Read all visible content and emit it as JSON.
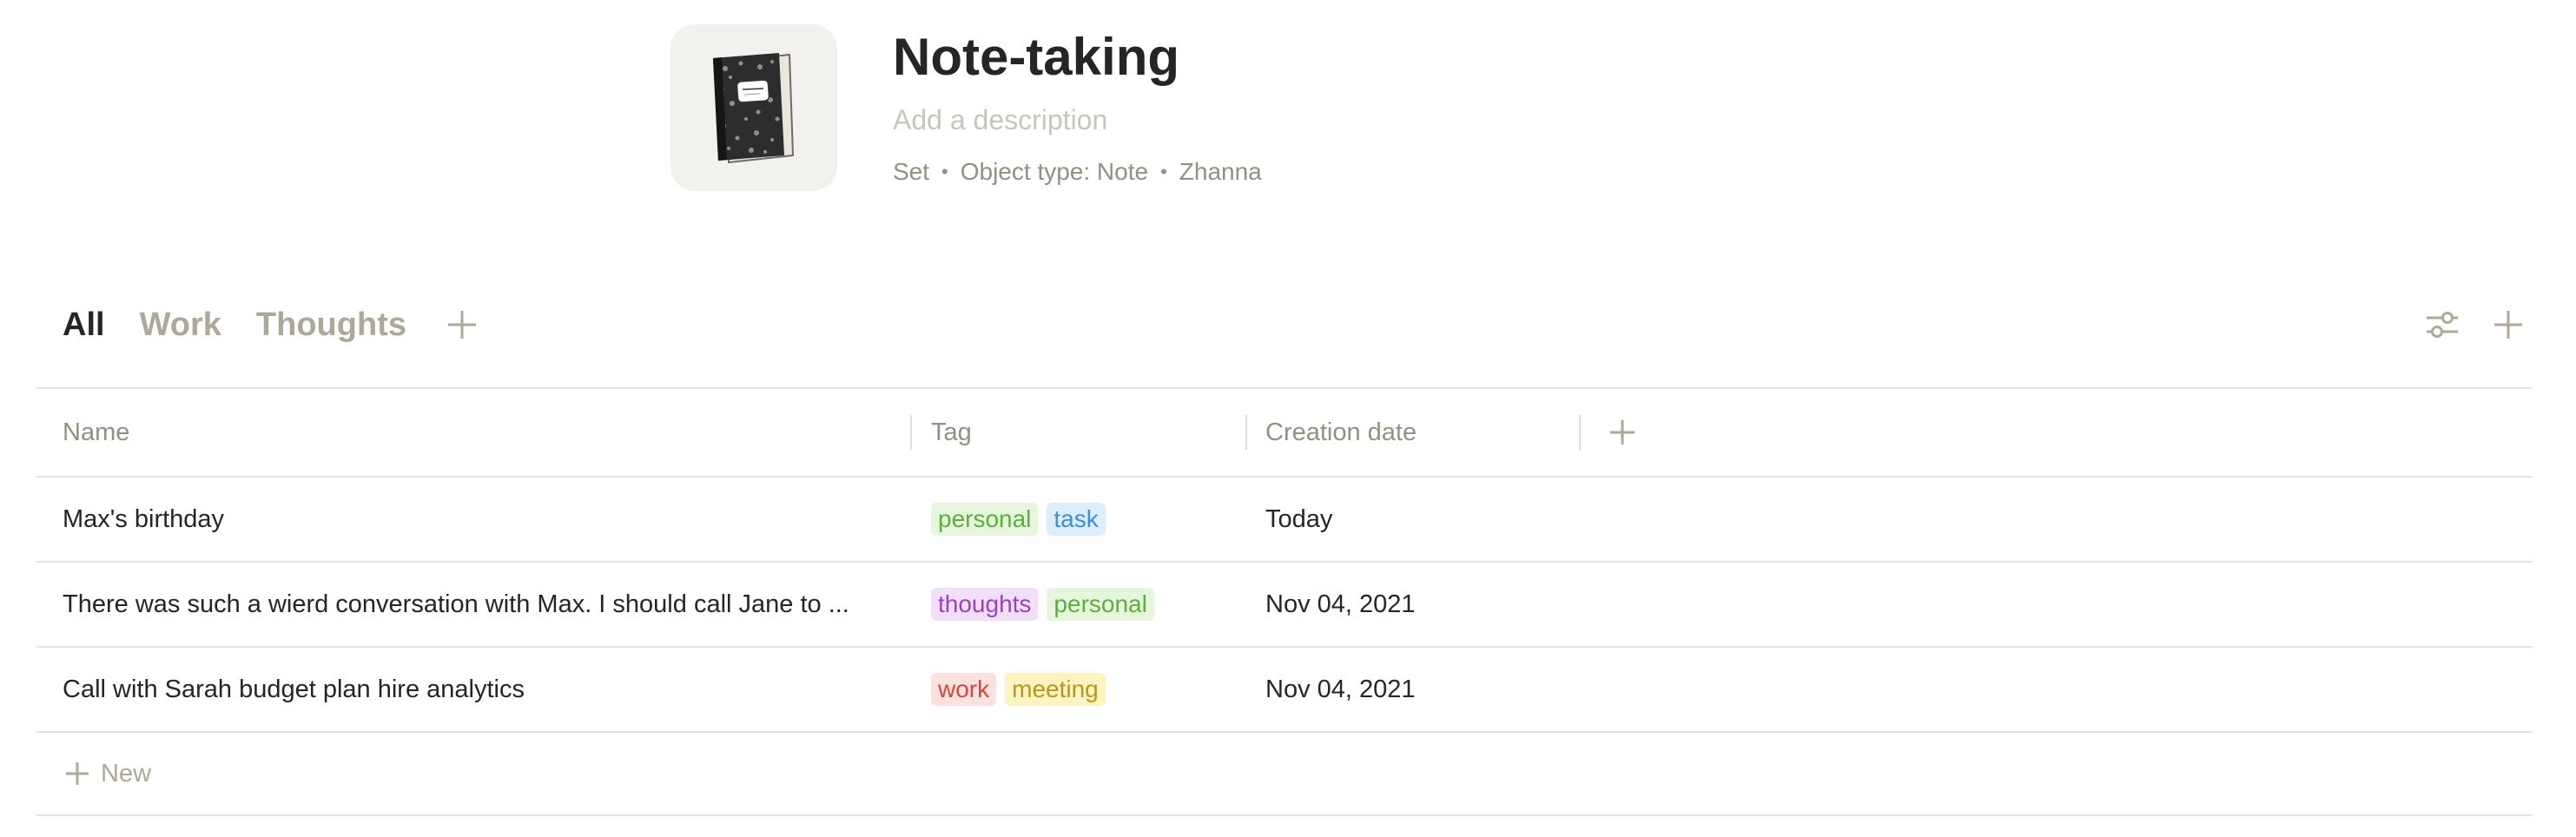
{
  "header": {
    "icon": "notebook-icon",
    "title": "Note-taking",
    "description_placeholder": "Add a description",
    "meta": {
      "kind": "Set",
      "object_type": "Object type: Note",
      "author": "Zhanna"
    }
  },
  "views": {
    "tabs": [
      {
        "label": "All",
        "active": true
      },
      {
        "label": "Work",
        "active": false
      },
      {
        "label": "Thoughts",
        "active": false
      }
    ],
    "add_icon": "plus-icon",
    "toolbar_icons": [
      "settings-sliders-icon",
      "plus-icon"
    ]
  },
  "table": {
    "columns": [
      "Name",
      "Tag",
      "Creation date"
    ],
    "add_column_icon": "plus-icon",
    "rows": [
      {
        "name": "Max's birthday",
        "tags": [
          {
            "label": "personal",
            "color": "#5dae3b",
            "bg": "#e6f6dc"
          },
          {
            "label": "task",
            "color": "#3e8fd8",
            "bg": "#dcedfb"
          }
        ],
        "date": "Today"
      },
      {
        "name": "There was such a wierd conversation with Max. I should call Jane to ...",
        "tags": [
          {
            "label": "thoughts",
            "color": "#9b3fc4",
            "bg": "#f1dff8"
          },
          {
            "label": "personal",
            "color": "#5dae3b",
            "bg": "#e6f6dc"
          }
        ],
        "date": "Nov 04, 2021"
      },
      {
        "name": "Call with Sarah budget plan hire analytics",
        "tags": [
          {
            "label": "work",
            "color": "#d1473b",
            "bg": "#fbe1dd"
          },
          {
            "label": "meeting",
            "color": "#b8981c",
            "bg": "#fbf3c2"
          }
        ],
        "date": "Nov 04, 2021"
      }
    ],
    "new_label": "New"
  }
}
